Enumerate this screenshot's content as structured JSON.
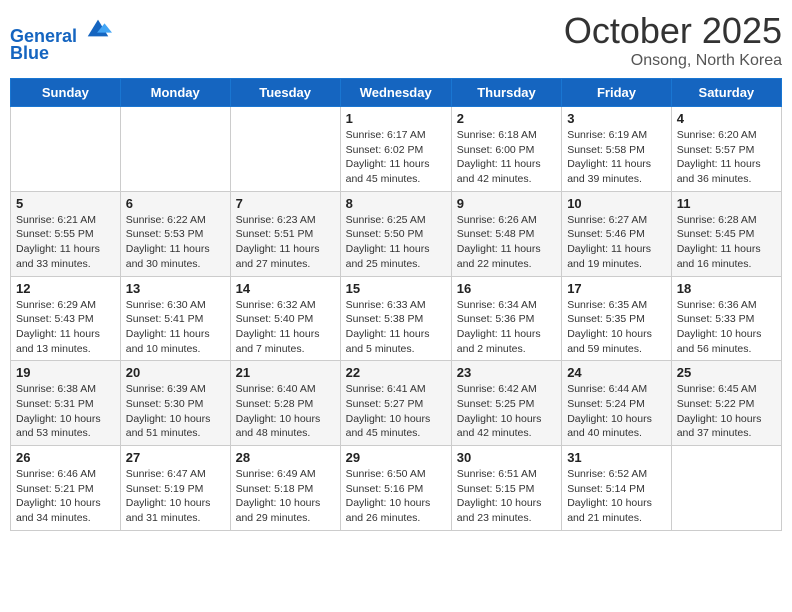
{
  "header": {
    "logo_line1": "General",
    "logo_line2": "Blue",
    "month": "October 2025",
    "location": "Onsong, North Korea"
  },
  "weekdays": [
    "Sunday",
    "Monday",
    "Tuesday",
    "Wednesday",
    "Thursday",
    "Friday",
    "Saturday"
  ],
  "weeks": [
    [
      {
        "day": "",
        "sunrise": "",
        "sunset": "",
        "daylight": ""
      },
      {
        "day": "",
        "sunrise": "",
        "sunset": "",
        "daylight": ""
      },
      {
        "day": "",
        "sunrise": "",
        "sunset": "",
        "daylight": ""
      },
      {
        "day": "1",
        "sunrise": "Sunrise: 6:17 AM",
        "sunset": "Sunset: 6:02 PM",
        "daylight": "Daylight: 11 hours and 45 minutes."
      },
      {
        "day": "2",
        "sunrise": "Sunrise: 6:18 AM",
        "sunset": "Sunset: 6:00 PM",
        "daylight": "Daylight: 11 hours and 42 minutes."
      },
      {
        "day": "3",
        "sunrise": "Sunrise: 6:19 AM",
        "sunset": "Sunset: 5:58 PM",
        "daylight": "Daylight: 11 hours and 39 minutes."
      },
      {
        "day": "4",
        "sunrise": "Sunrise: 6:20 AM",
        "sunset": "Sunset: 5:57 PM",
        "daylight": "Daylight: 11 hours and 36 minutes."
      }
    ],
    [
      {
        "day": "5",
        "sunrise": "Sunrise: 6:21 AM",
        "sunset": "Sunset: 5:55 PM",
        "daylight": "Daylight: 11 hours and 33 minutes."
      },
      {
        "day": "6",
        "sunrise": "Sunrise: 6:22 AM",
        "sunset": "Sunset: 5:53 PM",
        "daylight": "Daylight: 11 hours and 30 minutes."
      },
      {
        "day": "7",
        "sunrise": "Sunrise: 6:23 AM",
        "sunset": "Sunset: 5:51 PM",
        "daylight": "Daylight: 11 hours and 27 minutes."
      },
      {
        "day": "8",
        "sunrise": "Sunrise: 6:25 AM",
        "sunset": "Sunset: 5:50 PM",
        "daylight": "Daylight: 11 hours and 25 minutes."
      },
      {
        "day": "9",
        "sunrise": "Sunrise: 6:26 AM",
        "sunset": "Sunset: 5:48 PM",
        "daylight": "Daylight: 11 hours and 22 minutes."
      },
      {
        "day": "10",
        "sunrise": "Sunrise: 6:27 AM",
        "sunset": "Sunset: 5:46 PM",
        "daylight": "Daylight: 11 hours and 19 minutes."
      },
      {
        "day": "11",
        "sunrise": "Sunrise: 6:28 AM",
        "sunset": "Sunset: 5:45 PM",
        "daylight": "Daylight: 11 hours and 16 minutes."
      }
    ],
    [
      {
        "day": "12",
        "sunrise": "Sunrise: 6:29 AM",
        "sunset": "Sunset: 5:43 PM",
        "daylight": "Daylight: 11 hours and 13 minutes."
      },
      {
        "day": "13",
        "sunrise": "Sunrise: 6:30 AM",
        "sunset": "Sunset: 5:41 PM",
        "daylight": "Daylight: 11 hours and 10 minutes."
      },
      {
        "day": "14",
        "sunrise": "Sunrise: 6:32 AM",
        "sunset": "Sunset: 5:40 PM",
        "daylight": "Daylight: 11 hours and 7 minutes."
      },
      {
        "day": "15",
        "sunrise": "Sunrise: 6:33 AM",
        "sunset": "Sunset: 5:38 PM",
        "daylight": "Daylight: 11 hours and 5 minutes."
      },
      {
        "day": "16",
        "sunrise": "Sunrise: 6:34 AM",
        "sunset": "Sunset: 5:36 PM",
        "daylight": "Daylight: 11 hours and 2 minutes."
      },
      {
        "day": "17",
        "sunrise": "Sunrise: 6:35 AM",
        "sunset": "Sunset: 5:35 PM",
        "daylight": "Daylight: 10 hours and 59 minutes."
      },
      {
        "day": "18",
        "sunrise": "Sunrise: 6:36 AM",
        "sunset": "Sunset: 5:33 PM",
        "daylight": "Daylight: 10 hours and 56 minutes."
      }
    ],
    [
      {
        "day": "19",
        "sunrise": "Sunrise: 6:38 AM",
        "sunset": "Sunset: 5:31 PM",
        "daylight": "Daylight: 10 hours and 53 minutes."
      },
      {
        "day": "20",
        "sunrise": "Sunrise: 6:39 AM",
        "sunset": "Sunset: 5:30 PM",
        "daylight": "Daylight: 10 hours and 51 minutes."
      },
      {
        "day": "21",
        "sunrise": "Sunrise: 6:40 AM",
        "sunset": "Sunset: 5:28 PM",
        "daylight": "Daylight: 10 hours and 48 minutes."
      },
      {
        "day": "22",
        "sunrise": "Sunrise: 6:41 AM",
        "sunset": "Sunset: 5:27 PM",
        "daylight": "Daylight: 10 hours and 45 minutes."
      },
      {
        "day": "23",
        "sunrise": "Sunrise: 6:42 AM",
        "sunset": "Sunset: 5:25 PM",
        "daylight": "Daylight: 10 hours and 42 minutes."
      },
      {
        "day": "24",
        "sunrise": "Sunrise: 6:44 AM",
        "sunset": "Sunset: 5:24 PM",
        "daylight": "Daylight: 10 hours and 40 minutes."
      },
      {
        "day": "25",
        "sunrise": "Sunrise: 6:45 AM",
        "sunset": "Sunset: 5:22 PM",
        "daylight": "Daylight: 10 hours and 37 minutes."
      }
    ],
    [
      {
        "day": "26",
        "sunrise": "Sunrise: 6:46 AM",
        "sunset": "Sunset: 5:21 PM",
        "daylight": "Daylight: 10 hours and 34 minutes."
      },
      {
        "day": "27",
        "sunrise": "Sunrise: 6:47 AM",
        "sunset": "Sunset: 5:19 PM",
        "daylight": "Daylight: 10 hours and 31 minutes."
      },
      {
        "day": "28",
        "sunrise": "Sunrise: 6:49 AM",
        "sunset": "Sunset: 5:18 PM",
        "daylight": "Daylight: 10 hours and 29 minutes."
      },
      {
        "day": "29",
        "sunrise": "Sunrise: 6:50 AM",
        "sunset": "Sunset: 5:16 PM",
        "daylight": "Daylight: 10 hours and 26 minutes."
      },
      {
        "day": "30",
        "sunrise": "Sunrise: 6:51 AM",
        "sunset": "Sunset: 5:15 PM",
        "daylight": "Daylight: 10 hours and 23 minutes."
      },
      {
        "day": "31",
        "sunrise": "Sunrise: 6:52 AM",
        "sunset": "Sunset: 5:14 PM",
        "daylight": "Daylight: 10 hours and 21 minutes."
      },
      {
        "day": "",
        "sunrise": "",
        "sunset": "",
        "daylight": ""
      }
    ]
  ]
}
